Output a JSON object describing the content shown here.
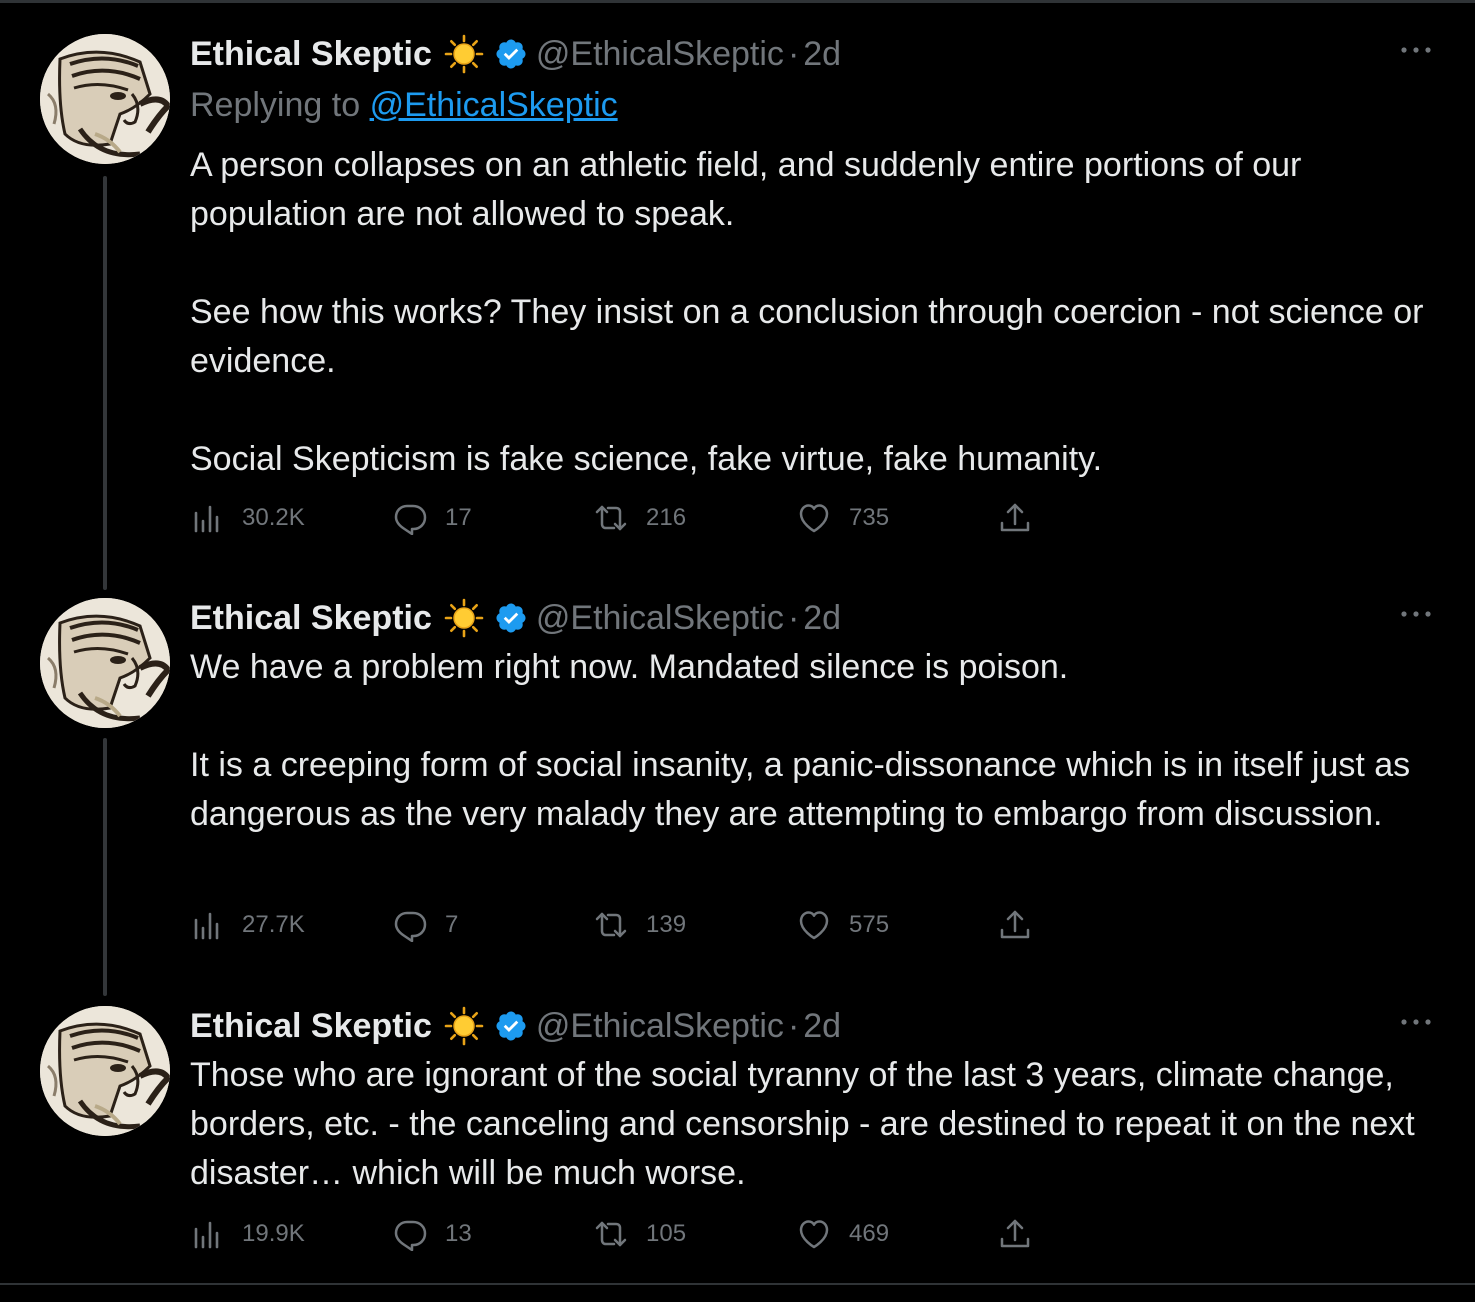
{
  "tweets": [
    {
      "author_name": "Ethical Skeptic",
      "handle": "@EthicalSkeptic",
      "separator": "·",
      "time": "2d",
      "replying_prefix": "Replying to",
      "replying_to": "@EthicalSkeptic",
      "paragraphs": [
        "A person collapses on an athletic field, and suddenly entire portions of our population are not allowed to speak.",
        "See how this works? They insist on a conclusion through coercion - not science or evidence.",
        "Social Skepticism is fake science, fake virtue, fake humanity."
      ],
      "views": "30.2K",
      "replies": "17",
      "retweets": "216",
      "likes": "735"
    },
    {
      "author_name": "Ethical Skeptic",
      "handle": "@EthicalSkeptic",
      "separator": "·",
      "time": "2d",
      "paragraphs": [
        "We have a problem right now. Mandated silence is poison.",
        "It is a creeping form of social insanity, a panic-dissonance which is in itself just as dangerous as the very malady they are attempting to embargo from discussion."
      ],
      "views": "27.7K",
      "replies": "7",
      "retweets": "139",
      "likes": "575"
    },
    {
      "author_name": "Ethical Skeptic",
      "handle": "@EthicalSkeptic",
      "separator": "·",
      "time": "2d",
      "paragraphs": [
        "Those who are ignorant of the social tyranny of the last 3 years, climate change, borders, etc. - the canceling and censorship - are destined to repeat it on the next disaster…  which will be much worse."
      ],
      "views": "19.9K",
      "replies": "13",
      "retweets": "105",
      "likes": "469"
    }
  ],
  "colors": {
    "background": "#000000",
    "text_primary": "#e7e9ea",
    "text_secondary": "#71767b",
    "link": "#1d9bf0",
    "verified": "#1d9bf0",
    "sun": "#ffcc33",
    "thread_line": "#333639"
  },
  "icons": {
    "author_emoji": "sun-icon",
    "verified": "verified-badge-icon",
    "more": "more-dots-icon",
    "views": "views-chart-icon",
    "reply": "reply-bubble-icon",
    "retweet": "retweet-icon",
    "like": "heart-icon",
    "share": "share-upload-icon"
  }
}
